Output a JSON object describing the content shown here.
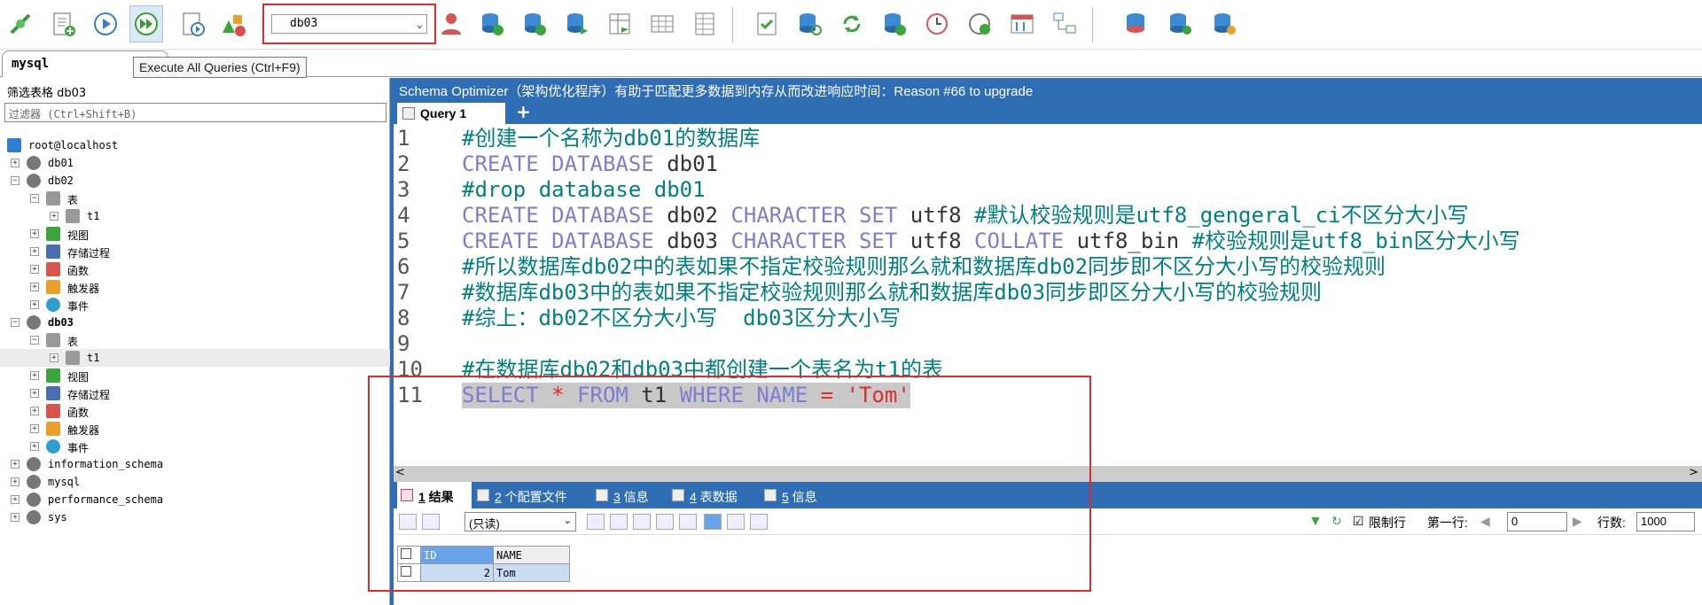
{
  "toolbar": {
    "db_select_value": "db03",
    "db_select_arrow": "⌄"
  },
  "connection_tab": {
    "label": "mysql"
  },
  "tooltip": {
    "text": "Execute All Queries (Ctrl+F9)"
  },
  "left_pane": {
    "filter_label": "筛选表格 db03",
    "filter_placeholder": "过滤器 (Ctrl+Shift+B)",
    "tree": [
      {
        "label": "root@localhost",
        "icon": "server-icon"
      },
      {
        "label": "db01",
        "icon": "database-icon",
        "toggle": "+"
      },
      {
        "label": "db02",
        "icon": "database-icon",
        "toggle": "−"
      },
      {
        "label": "表",
        "icon": "table-folder-icon",
        "toggle": "−"
      },
      {
        "label": "t1",
        "icon": "table-icon",
        "toggle": "+"
      },
      {
        "label": "视图",
        "icon": "view-icon",
        "toggle": "+"
      },
      {
        "label": "存储过程",
        "icon": "gear-icon",
        "toggle": "+"
      },
      {
        "label": "函数",
        "icon": "function-icon",
        "toggle": "+"
      },
      {
        "label": "触发器",
        "icon": "lightning-icon",
        "toggle": "+"
      },
      {
        "label": "事件",
        "icon": "clock-icon",
        "toggle": "+"
      },
      {
        "label": "db03",
        "icon": "database-icon",
        "toggle": "−",
        "bold": true
      },
      {
        "label": "表",
        "icon": "table-folder-icon",
        "toggle": "−"
      },
      {
        "label": "t1",
        "icon": "table-icon",
        "toggle": "+"
      },
      {
        "label": "视图",
        "icon": "view-icon",
        "toggle": "+"
      },
      {
        "label": "存储过程",
        "icon": "gear-icon",
        "toggle": "+"
      },
      {
        "label": "函数",
        "icon": "function-icon",
        "toggle": "+"
      },
      {
        "label": "触发器",
        "icon": "lightning-icon",
        "toggle": "+"
      },
      {
        "label": "事件",
        "icon": "clock-icon",
        "toggle": "+"
      },
      {
        "label": "information_schema",
        "icon": "database-icon",
        "toggle": "+"
      },
      {
        "label": "mysql",
        "icon": "database-icon",
        "toggle": "+"
      },
      {
        "label": "performance_schema",
        "icon": "database-icon",
        "toggle": "+"
      },
      {
        "label": "sys",
        "icon": "database-icon",
        "toggle": "+"
      }
    ]
  },
  "right_pane": {
    "banner": "Schema Optimizer（架构优化程序）有助于匹配更多数据到内存从而改进响应时间：Reason #66 to upgrade",
    "query_tab": "Query 1",
    "add_tab": "+",
    "editor": {
      "line_numbers": [
        "1",
        "2",
        "3",
        "4",
        "5",
        "6",
        "7",
        "8",
        "9",
        "10",
        "11"
      ],
      "l1": "#创建一个名称为db01的数据库",
      "l2_kw": "CREATE DATABASE",
      "l2_id": " db01",
      "l3": "#drop database db01",
      "l4_kw1": "CREATE DATABASE",
      "l4_id1": " db02 ",
      "l4_kw2": "CHARACTER SET",
      "l4_id2": " utf8 ",
      "l4_cmt": "#默认校验规则是utf8_gengeral_ci不区分大小写",
      "l5_kw1": "CREATE DATABASE",
      "l5_id1": " db03 ",
      "l5_kw2": "CHARACTER SET",
      "l5_id2": " utf8 ",
      "l5_kw3": "COLLATE",
      "l5_id3": " utf8_bin ",
      "l5_cmt": "#校验规则是utf8_bin区分大小写",
      "l6": "#所以数据库db02中的表如果不指定校验规则那么就和数据库db02同步即不区分大小写的校验规则",
      "l7": "#数据库db03中的表如果不指定校验规则那么就和数据库db03同步即区分大小写的校验规则",
      "l8": "#综上：db02不区分大小写  db03区分大小写",
      "l9": "",
      "l10": "#在数据库db02和db03中都创建一个表名为t1的表",
      "l11_kw1": "SELECT",
      "l11_op1": " * ",
      "l11_kw2": "FROM",
      "l11_id1": " t1 ",
      "l11_kw3": "WHERE NAME",
      "l11_op2": " = ",
      "l11_str": "'Tom'"
    },
    "result_tabs": [
      {
        "num": "1",
        "label": " 结果"
      },
      {
        "num": "2",
        "label": " 个配置文件"
      },
      {
        "num": "3",
        "label": " 信息"
      },
      {
        "num": "4",
        "label": " 表数据"
      },
      {
        "num": "5",
        "label": " 信息"
      }
    ],
    "result_toolbar": {
      "readonly": "(只读)",
      "limit_label": "限制行",
      "first_row_label": "第一行:",
      "first_row_value": "0",
      "rows_label": "行数:",
      "rows_value": "1000"
    },
    "grid": {
      "columns": [
        "ID",
        "NAME"
      ],
      "rows": [
        [
          "2",
          "Tom"
        ]
      ]
    }
  }
}
